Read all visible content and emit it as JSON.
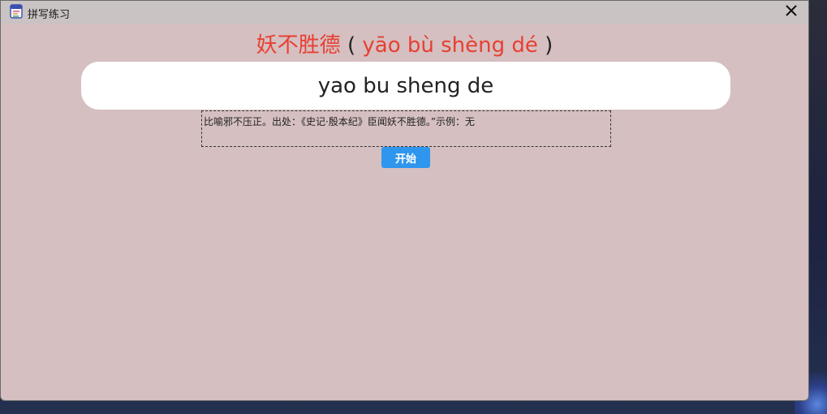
{
  "window": {
    "title": "拼写练习"
  },
  "idiom": {
    "characters": "妖不胜德",
    "open_paren": "(",
    "pinyin": "yāo bù shèng dé",
    "close_paren": ")"
  },
  "answer": {
    "value": "yao bu sheng de"
  },
  "explanation": {
    "text": "比喻邪不压正。出处：《史记·殷本纪》臣闻妖不胜德。”示例：无"
  },
  "controls": {
    "start_label": "开始"
  },
  "colors": {
    "accent_red": "#e83f33",
    "button_blue": "#2f96ee",
    "window_bg": "#d5bfc0",
    "titlebar_bg": "#c9c3c3"
  },
  "icons": {
    "app": "notebook-icon",
    "close": "close-icon"
  }
}
